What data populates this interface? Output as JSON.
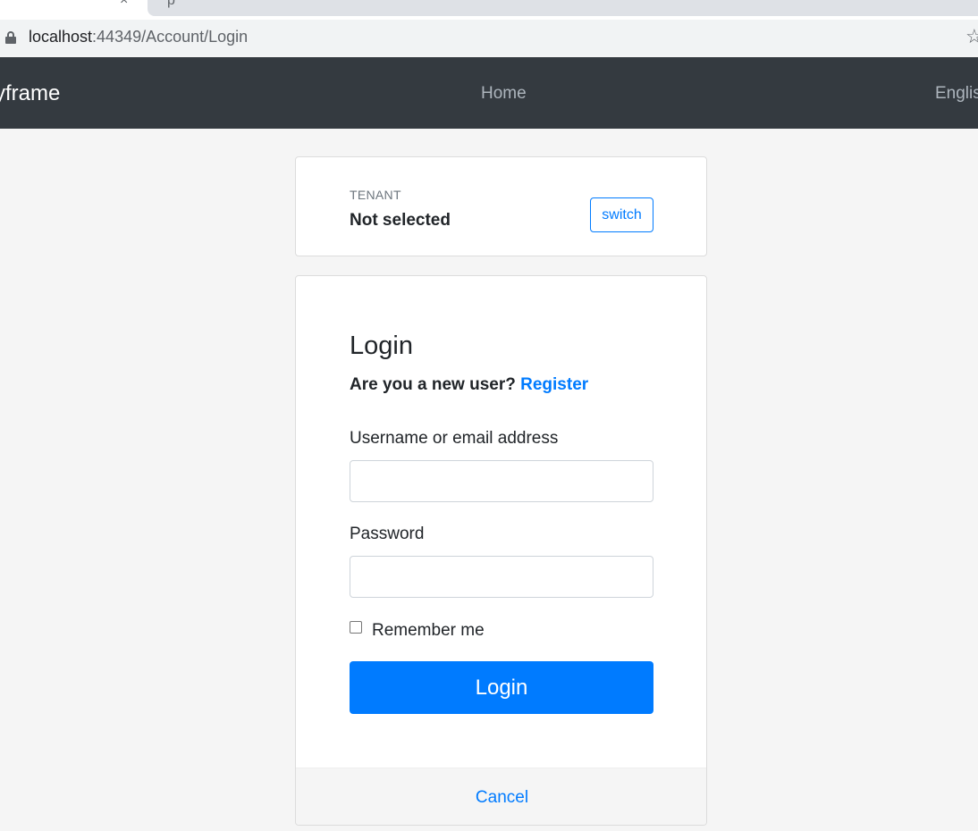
{
  "browser": {
    "tab_glyph": "p",
    "url_host": "localhost",
    "url_path": ":44349/Account/Login",
    "icons": [
      "lock-icon",
      "star-icon",
      "close-icon"
    ]
  },
  "navbar": {
    "brand": "yframe",
    "home": "Home",
    "language": "Englis"
  },
  "tenant": {
    "caption": "TENANT",
    "name": "Not selected",
    "switch_label": "switch"
  },
  "login": {
    "title": "Login",
    "new_user_text": "Are you a new user?",
    "register_label": "Register",
    "username_label": "Username or email address",
    "username_value": "",
    "password_label": "Password",
    "password_value": "",
    "remember_label": "Remember me",
    "remember_checked": false,
    "submit_label": "Login",
    "cancel_label": "Cancel"
  },
  "colors": {
    "navbar": "#343a40",
    "primary": "#007bff",
    "page_background": "#f5f5f5"
  }
}
